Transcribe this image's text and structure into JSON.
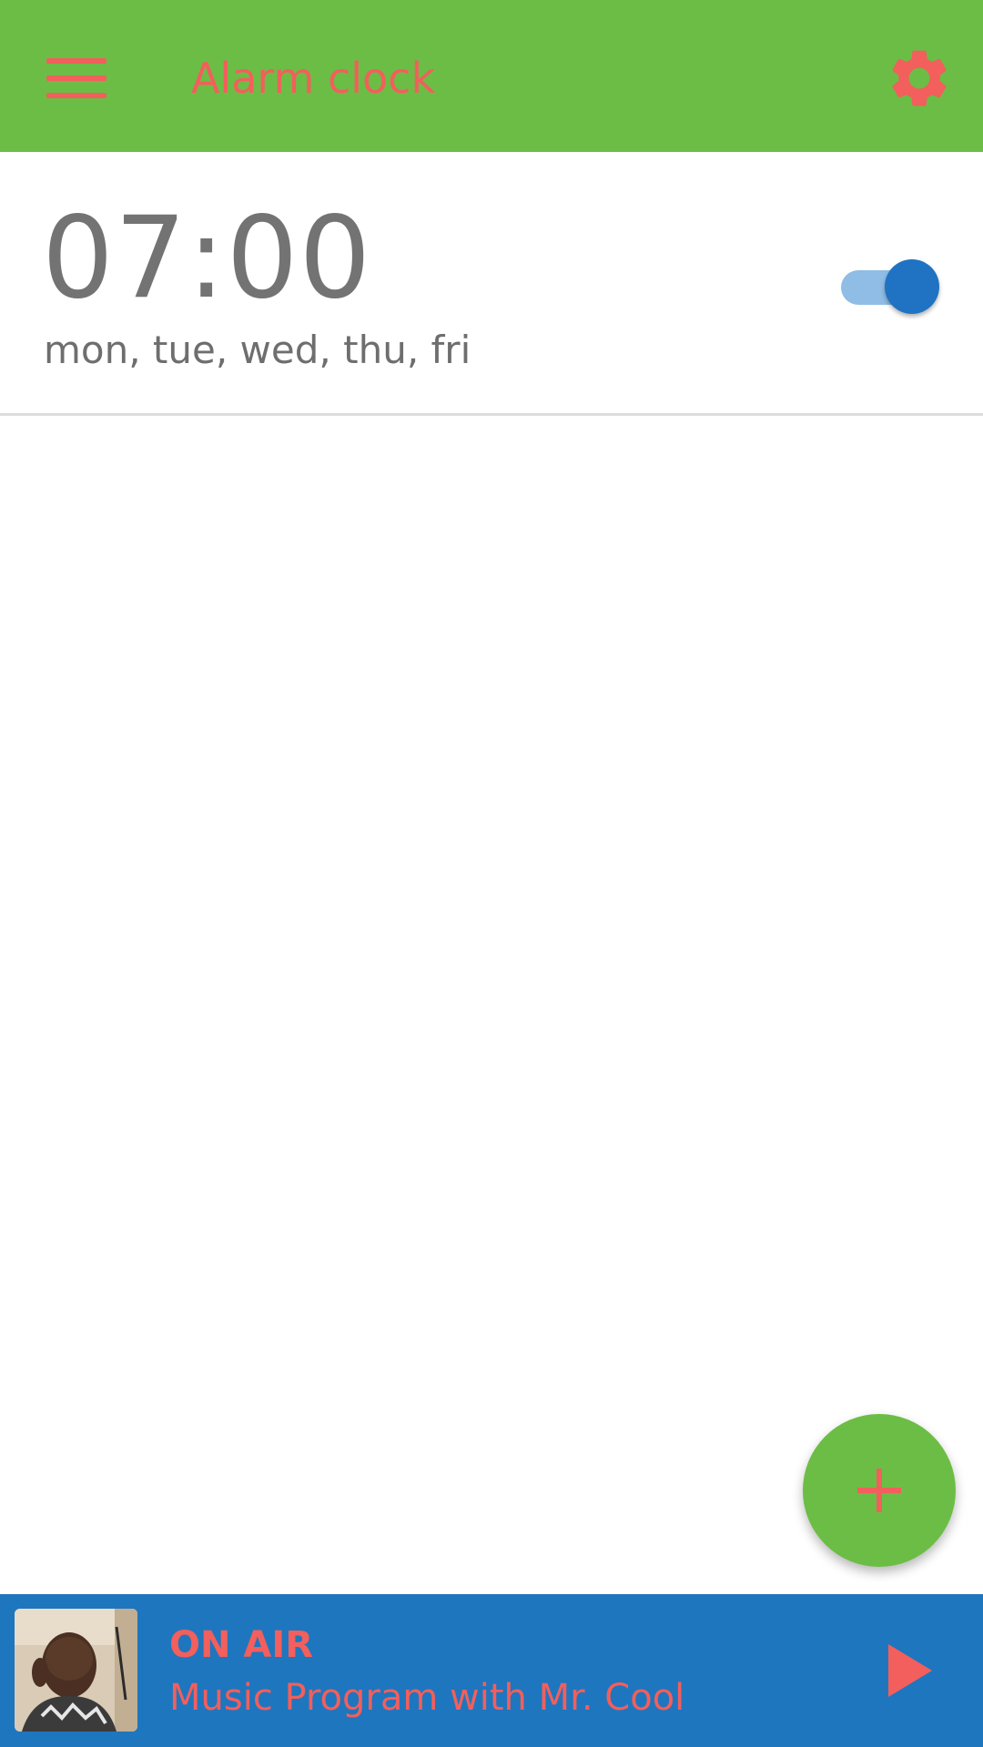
{
  "toolbar": {
    "title": "Alarm clock",
    "menu_icon": "hamburger-menu-icon",
    "settings_icon": "gear-icon"
  },
  "alarms": [
    {
      "time": "07:00",
      "days": "mon, tue, wed, thu, fri",
      "enabled": true
    }
  ],
  "fab": {
    "icon": "plus-icon"
  },
  "player": {
    "status": "ON AIR",
    "program": "Music Program with Mr. Cool",
    "play_icon": "play-icon"
  },
  "colors": {
    "toolbar_bg": "#6cbd45",
    "accent_text": "#f25f5c",
    "player_bg": "#1e76be",
    "toggle_on": "#1f73c2"
  }
}
